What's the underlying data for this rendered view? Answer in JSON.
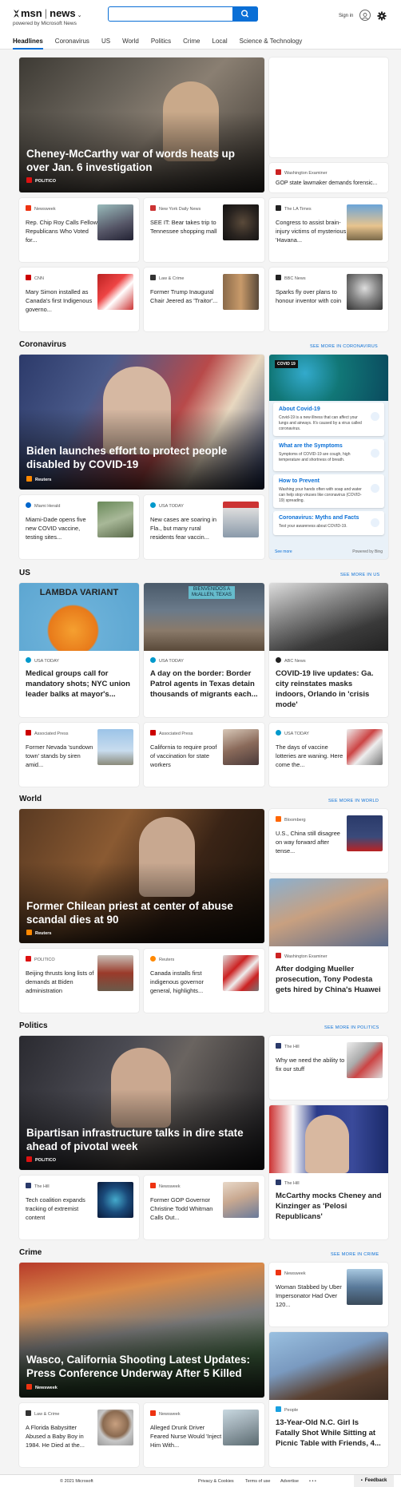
{
  "brand": {
    "msn": "msn",
    "sep": "|",
    "news": "news",
    "tagline": "powered by Microsoft News"
  },
  "search": {
    "value": "",
    "button": "search"
  },
  "header": {
    "signin": "Sign in"
  },
  "nav": [
    "Headlines",
    "Coronavirus",
    "US",
    "World",
    "Politics",
    "Crime",
    "Local",
    "Science & Technology"
  ],
  "headlines": {
    "hero": {
      "title": "Cheney-McCarthy war of words heats up over Jan. 6 investigation",
      "source": "POLITICO"
    },
    "side": {
      "source": "Washington Examiner",
      "text": "GOP state lawmaker demands forensic..."
    },
    "row1": [
      {
        "source": "Newsweek",
        "text": "Rep. Chip Roy Calls Fellow Republicans Who Voted for..."
      },
      {
        "source": "New York Daily News",
        "text": "SEE IT: Bear takes trip to Tennessee shopping mall"
      },
      {
        "source": "The LA Times",
        "text": "Congress to assist brain-injury victims of mysterious 'Havana..."
      }
    ],
    "row2": [
      {
        "source": "CNN",
        "text": "Mary Simon installed as Canada's first Indigenous governo..."
      },
      {
        "source": "Law & Crime",
        "text": "Former Trump Inaugural Chair Jeered as 'Traitor'..."
      },
      {
        "source": "BBC News",
        "text": "Sparks fly over plans to honour inventor with coin"
      }
    ]
  },
  "coronavirus": {
    "heading": "Coronavirus",
    "see_more": "SEE MORE IN CORONAVIRUS",
    "hero": {
      "title": "Biden launches effort to protect people disabled by COVID-19",
      "source": "Reuters"
    },
    "row": [
      {
        "source": "Miami Herald",
        "text": "Miami-Dade opens five new COVID vaccine, testing sites..."
      },
      {
        "source": "USA TODAY",
        "text": "New cases are soaring in Fla., but many rural residents fear vaccin..."
      }
    ],
    "panel": {
      "tag": "COVID 19",
      "items": [
        {
          "title": "About Covid-19",
          "desc": "Covid-19 is a new illness that can affect your lungs and airways. It's caused by a virus called coronavirus."
        },
        {
          "title": "What are the Symptoms",
          "desc": "Symptoms of COVID-19 are cough, high temperature and shortness of breath."
        },
        {
          "title": "How to Prevent",
          "desc": "Washing your hands often with soap and water can help stop viruses like coronavirus (COVID-19) spreading."
        },
        {
          "title": "Coronavirus: Myths and Facts",
          "desc": "Test your awareness about COVID-19."
        }
      ],
      "see_more": "See more",
      "powered": "Powered by Bing"
    }
  },
  "us": {
    "heading": "US",
    "see_more": "SEE MORE IN US",
    "tall": [
      {
        "source": "USA TODAY",
        "text": "Medical groups call for mandatory shots; NYC union leader balks at mayor's...",
        "img_text": "LAMBDA VARIANT"
      },
      {
        "source": "USA TODAY",
        "text": "A day on the border: Border Patrol agents in Texas detain thousands of migrants each...",
        "img_text": "BIENVENIDOS A McALLEN, TEXAS"
      },
      {
        "source": "ABC News",
        "text": "COVID-19 live updates: Ga. city reinstates masks indoors, Orlando in 'crisis mode'"
      }
    ],
    "row": [
      {
        "source": "Associated Press",
        "text": "Former Nevada 'sundown town' stands by siren amid..."
      },
      {
        "source": "Associated Press",
        "text": "California to require proof of vaccination for state workers"
      },
      {
        "source": "USA TODAY",
        "text": "The days of vaccine lotteries are waning. Here come the..."
      }
    ]
  },
  "world": {
    "heading": "World",
    "see_more": "SEE MORE IN WORLD",
    "hero": {
      "title": "Former Chilean priest at center of abuse scandal dies at 90",
      "source": "Reuters"
    },
    "side_small": {
      "source": "Bloomberg",
      "text": "U.S., China still disagree on way forward after tense..."
    },
    "side_tall": {
      "source": "Washington Examiner",
      "text": "After dodging Mueller prosecution, Tony Podesta gets hired by China's Huawei"
    },
    "row": [
      {
        "source": "POLITICO",
        "text": "Beijing thrusts long lists of demands at Biden administration"
      },
      {
        "source": "Reuters",
        "text": "Canada installs first indigenous governor general, highlights..."
      }
    ]
  },
  "politics": {
    "heading": "Politics",
    "see_more": "SEE MORE IN POLITICS",
    "hero": {
      "title": "Bipartisan infrastructure talks in dire state ahead of pivotal week",
      "source": "POLITICO"
    },
    "side_small": {
      "source": "The Hill",
      "text": "Why we need the ability to fix our stuff"
    },
    "side_tall": {
      "source": "The Hill",
      "text": "McCarthy mocks Cheney and Kinzinger as 'Pelosi Republicans'"
    },
    "row": [
      {
        "source": "The Hill",
        "text": "Tech coalition expands tracking of extremist content"
      },
      {
        "source": "Newsweek",
        "text": "Former GOP Governor Christine Todd Whitman Calls Out..."
      }
    ]
  },
  "crime": {
    "heading": "Crime",
    "see_more": "SEE MORE IN CRIME",
    "hero": {
      "title": "Wasco, California Shooting Latest Updates: Press Conference Underway After 5 Killed",
      "source": "Newsweek"
    },
    "side_small": {
      "source": "Newsweek",
      "text": "Woman Stabbed by Uber Impersonator Had Over 120..."
    },
    "side_tall": {
      "source": "People",
      "text": "13-Year-Old N.C. Girl Is Fatally Shot While Sitting at Picnic Table with Friends, 4..."
    },
    "row": [
      {
        "source": "Law & Crime",
        "text": "A Florida Babysitter Abused a Baby Boy in 1984. He Died at the..."
      },
      {
        "source": "Newsweek",
        "text": "Alleged Drunk Driver Feared Nurse Would 'Inject Him With..."
      }
    ]
  },
  "footer": {
    "copyright": "© 2021 Microsoft",
    "privacy": "Privacy & Cookies",
    "terms": "Terms of use",
    "advertise": "Advertise",
    "more": "• • •",
    "feedback": "Feedback"
  }
}
